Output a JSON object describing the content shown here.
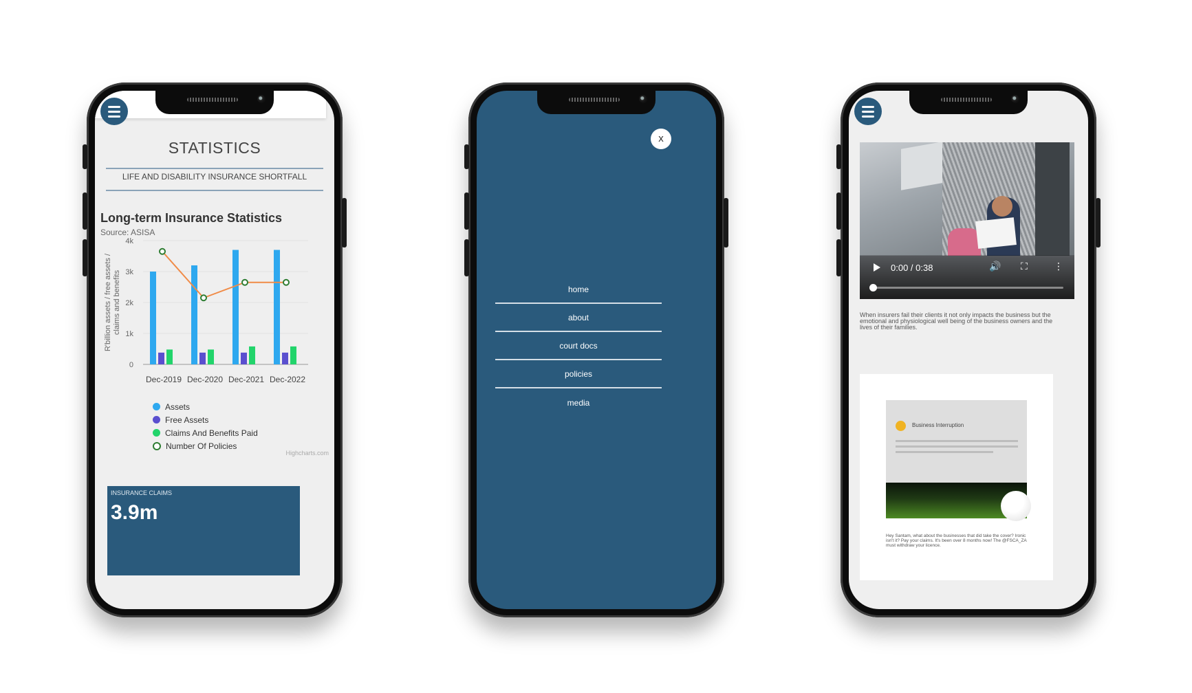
{
  "phones": [
    {
      "screen": "statistics",
      "page_title": "STATISTICS",
      "subtitle": "LIFE AND DISABILITY INSURANCE SHORTFALL",
      "chart_title": "Long-term Insurance Statistics",
      "chart_source": "Source: ASISA",
      "credits": "Highcharts.com",
      "claims_box": {
        "label": "INSURANCE CLAIMS",
        "value": "3.9m"
      }
    },
    {
      "screen": "navigation-menu",
      "close_label": "x",
      "nav_items": [
        "home",
        "about",
        "court docs",
        "policies",
        "media"
      ]
    },
    {
      "screen": "media",
      "video": {
        "time": "0:00 / 0:38"
      },
      "description": "When insurers fail their clients it not only impacts the business but the emotional and physiological well being of the business owners and the lives of their families.",
      "embed_card_title": "Business Interruption",
      "embed_caption": "Hey Santam, what about the businesses that did take the cover? Ironic isn't it? Pay your claims. It's been over 8 months now! The @FSCA_ZA must withdraw your licence."
    }
  ],
  "colors": {
    "brand_navy": "#2a5a7c",
    "assets": "#2ea8ef",
    "free_assets": "#5a4fcf",
    "claims": "#22d46b",
    "policies_line": "#f08b47",
    "policies_marker": "#2e7d32"
  },
  "icons": [
    "hamburger-menu-icon",
    "close-icon",
    "play-icon",
    "volume-icon",
    "fullscreen-icon",
    "more-vert-icon"
  ],
  "chart_data": {
    "type": "bar",
    "title": "Long-term Insurance Statistics",
    "subtitle": "Source: ASISA",
    "categories": [
      "Dec-2019",
      "Dec-2020",
      "Dec-2021",
      "Dec-2022"
    ],
    "ylabel": "R'billion assets / free assets / claims and benefits",
    "ylim": [
      0,
      4000
    ],
    "yticks": [
      "0",
      "1k",
      "2k",
      "3k",
      "4k"
    ],
    "grid": true,
    "legend": "bottom-left",
    "series": [
      {
        "name": "Assets",
        "type": "bar",
        "values": [
          3000,
          3200,
          3700,
          3700
        ]
      },
      {
        "name": "Free Assets",
        "type": "bar",
        "values": [
          380,
          380,
          380,
          380
        ]
      },
      {
        "name": "Claims And Benefits Paid",
        "type": "bar",
        "values": [
          480,
          480,
          580,
          580
        ]
      },
      {
        "name": "Number Of Policies",
        "type": "line",
        "values": [
          3650,
          2150,
          2650,
          2650
        ]
      }
    ]
  }
}
